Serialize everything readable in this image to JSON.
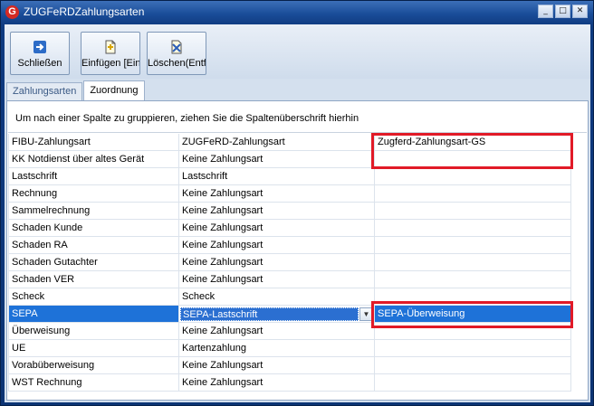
{
  "window": {
    "title": "ZUGFeRDZahlungsarten",
    "app_icon": "G"
  },
  "titlebar_buttons": {
    "minimize": "_",
    "maximize": "□",
    "close": "✕"
  },
  "toolbar": {
    "close_label": "Schließen",
    "insert_label": "Einfügen [Einfg]",
    "delete_label": "Löschen(Entf)"
  },
  "tabs": [
    {
      "label": "Zahlungsarten",
      "active": false
    },
    {
      "label": "Zuordnung",
      "active": true
    }
  ],
  "grid": {
    "group_hint": "Um nach einer Spalte zu gruppieren, ziehen Sie die Spaltenüberschrift hierhin",
    "columns": [
      "FIBU-Zahlungsart",
      "ZUGFeRD-Zahlungsart",
      "Zugferd-Zahlungsart-GS"
    ],
    "rows": [
      [
        "KK Notdienst über altes Gerät",
        "Keine Zahlungsart",
        ""
      ],
      [
        "Lastschrift",
        "Lastschrift",
        ""
      ],
      [
        "Rechnung",
        "Keine Zahlungsart",
        ""
      ],
      [
        "Sammelrechnung",
        "Keine Zahlungsart",
        ""
      ],
      [
        "Schaden  Kunde",
        "Keine Zahlungsart",
        ""
      ],
      [
        "Schaden  RA",
        "Keine Zahlungsart",
        ""
      ],
      [
        "Schaden Gutachter",
        "Keine Zahlungsart",
        ""
      ],
      [
        "Schaden VER",
        "Keine Zahlungsart",
        ""
      ],
      [
        "Scheck",
        "Scheck",
        ""
      ],
      [
        "SEPA",
        "SEPA-Lastschrift",
        "SEPA-Überweisung"
      ],
      [
        "Überweisung",
        "Keine Zahlungsart",
        ""
      ],
      [
        "UE",
        "Kartenzahlung",
        ""
      ],
      [
        "Vorabüberweisung",
        "Keine Zahlungsart",
        ""
      ],
      [
        "WST Rechnung",
        "Keine Zahlungsart",
        ""
      ]
    ],
    "selected_row": 9
  },
  "colors": {
    "highlight": "#e11a27",
    "selection": "#1e72d8"
  }
}
